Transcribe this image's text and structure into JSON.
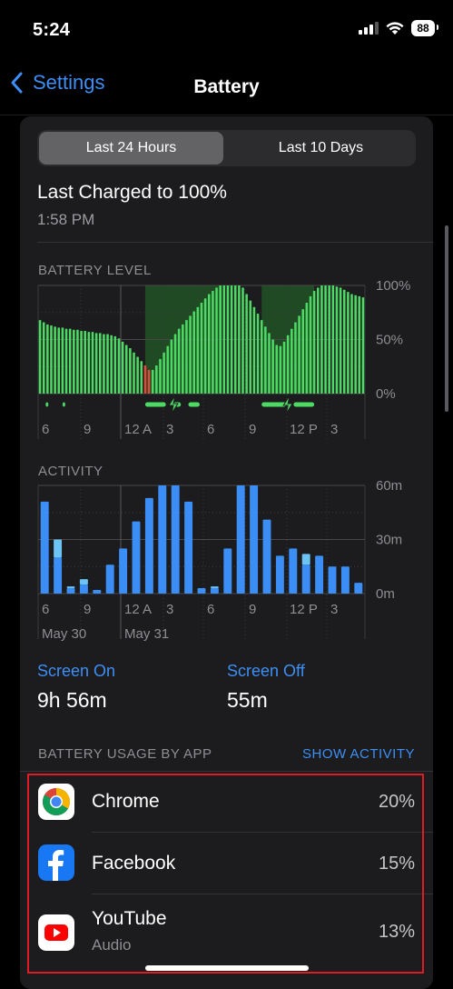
{
  "status_bar": {
    "time": "5:24",
    "battery": "88"
  },
  "nav": {
    "back_label": "Settings",
    "title": "Battery"
  },
  "segment": {
    "option1": "Last 24 Hours",
    "option2": "Last 10 Days",
    "selected": "Last 24 Hours"
  },
  "last_charged": {
    "title": "Last Charged to 100%",
    "time": "1:58 PM"
  },
  "battery_level": {
    "label": "BATTERY LEVEL",
    "y_ticks": [
      "100%",
      "50%",
      "0%"
    ],
    "x_ticks": [
      "6",
      "9",
      "12 A",
      "3",
      "6",
      "9",
      "12 P",
      "3"
    ]
  },
  "activity": {
    "label": "ACTIVITY",
    "y_ticks": [
      "60m",
      "30m",
      "0m"
    ],
    "x_ticks": [
      "6",
      "9",
      "12 A",
      "3",
      "6",
      "9",
      "12 P",
      "3"
    ],
    "dates": [
      "May 30",
      "May 31"
    ]
  },
  "screen": {
    "on_label": "Screen On",
    "on_value": "9h 56m",
    "off_label": "Screen Off",
    "off_value": "55m"
  },
  "usage": {
    "label": "BATTERY USAGE BY APP",
    "action": "SHOW ACTIVITY",
    "apps": [
      {
        "name": "Chrome",
        "subtitle": "",
        "percent": "20%"
      },
      {
        "name": "Facebook",
        "subtitle": "",
        "percent": "15%"
      },
      {
        "name": "YouTube",
        "subtitle": "Audio",
        "percent": "13%"
      }
    ]
  },
  "chart_data": [
    {
      "type": "bar",
      "title": "BATTERY LEVEL",
      "unit": "%",
      "ylim": [
        0,
        100
      ],
      "values": [
        68,
        66,
        64,
        63,
        62,
        61,
        61,
        60,
        60,
        59,
        59,
        58,
        58,
        57,
        57,
        56,
        56,
        55,
        55,
        54,
        53,
        51,
        48,
        45,
        42,
        38,
        34,
        30,
        26,
        22,
        22,
        26,
        32,
        38,
        44,
        50,
        55,
        60,
        64,
        68,
        72,
        76,
        80,
        84,
        88,
        92,
        95,
        98,
        100,
        100,
        100,
        100,
        100,
        100,
        98,
        92,
        86,
        80,
        74,
        68,
        62,
        56,
        50,
        45,
        44,
        48,
        54,
        60,
        66,
        72,
        78,
        84,
        90,
        95,
        98,
        100,
        100,
        100,
        100,
        99,
        98,
        96,
        94,
        92,
        91,
        90,
        89
      ],
      "low_indices": [
        28,
        29
      ]
    },
    {
      "type": "bar",
      "title": "ACTIVITY",
      "unit": "minutes",
      "ylim": [
        0,
        60
      ],
      "series": [
        {
          "name": "Screen On",
          "values": [
            51,
            20,
            3,
            5,
            2,
            16,
            25,
            40,
            53,
            60,
            60,
            51,
            3,
            3,
            25,
            60,
            60,
            41,
            21,
            25,
            16,
            21,
            15,
            15,
            6
          ]
        },
        {
          "name": "Screen Off",
          "values": [
            0,
            10,
            1,
            3,
            0,
            0,
            0,
            0,
            0,
            0,
            0,
            0,
            0,
            1,
            0,
            0,
            0,
            0,
            0,
            0,
            6,
            0,
            0,
            0,
            0
          ]
        }
      ]
    }
  ]
}
